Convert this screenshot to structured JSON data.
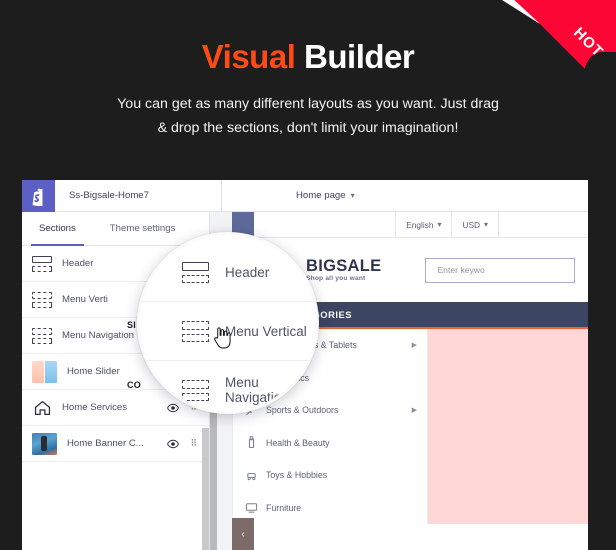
{
  "banner": {
    "title_part1": "Visual",
    "title_part2": "Builder",
    "subtitle_line1": "You can get as many different layouts as you want. Just drag",
    "subtitle_line2": "& drop the sections, don't limit your imagination!",
    "ribbon_label": "HOT",
    "colors": {
      "background": "#1e1d1d",
      "accent_orange": "#ff4a15",
      "ribbon_red": "#fb0635",
      "title_white": "#ffffff"
    }
  },
  "app": {
    "topbar": {
      "logo_icon": "shopify-bag-icon",
      "theme_name": "Ss-Bigsale-Home7",
      "page_selector_label": "Home page",
      "page_selector_caret": "⌄"
    },
    "sidebar": {
      "tabs": [
        {
          "label": "Sections",
          "active": true
        },
        {
          "label": "Theme settings",
          "active": false
        }
      ],
      "ghost_labels": [
        {
          "text": "SI"
        },
        {
          "text": "CO"
        }
      ],
      "sections": [
        {
          "label": "Header",
          "icon": "section-header-icon",
          "has_eye": false,
          "has_grip": false
        },
        {
          "label": "Menu Verti",
          "icon": "section-block-icon",
          "has_eye": false,
          "has_grip": false
        },
        {
          "label": "Menu Navigation",
          "icon": "section-block-icon",
          "has_eye": false,
          "has_grip": false
        },
        {
          "label": "Home Slider",
          "icon": "thumbnail-slider",
          "has_eye": true,
          "has_grip": true
        },
        {
          "label": "Home Services",
          "icon": "house-icon",
          "has_eye": true,
          "has_grip": true
        },
        {
          "label": "Home Banner C...",
          "icon": "thumbnail-photo",
          "has_eye": true,
          "has_grip": true
        }
      ]
    },
    "magnifier": {
      "items": [
        {
          "label": "Header",
          "icon": "section-header-icon"
        },
        {
          "label": "Menu Vertical",
          "icon": "section-block-icon"
        },
        {
          "label": "Menu Navigation",
          "icon": "section-block-icon"
        }
      ],
      "cursor": "pointer-hand-cursor"
    },
    "preview": {
      "utility_bar": [
        {
          "label": "English",
          "caret": "⌄"
        },
        {
          "label": "USD",
          "caret": "⌄"
        }
      ],
      "store": {
        "logo_name": "BIGSALE",
        "logo_tagline": "Shop all you want",
        "logo_icon": "shopping-basket-icon",
        "search_placeholder": "Enter keywo"
      },
      "categories_header": "ALL CATEGORIES",
      "categories": [
        {
          "label": "Smartphones & Tablets",
          "icon": "smartphone-icon",
          "has_arrow": true
        },
        {
          "label": "Electronics",
          "icon": "electronics-icon",
          "has_arrow": false
        },
        {
          "label": "Sports & Outdoors",
          "icon": "sports-icon",
          "has_arrow": true
        },
        {
          "label": "Health & Beauty",
          "icon": "beauty-bottle-icon",
          "has_arrow": false
        },
        {
          "label": "Toys & Hobbies",
          "icon": "toys-icon",
          "has_arrow": false
        },
        {
          "label": "Furniture",
          "icon": "furniture-icon",
          "has_arrow": false
        }
      ],
      "social": [
        {
          "name": "twitter-icon",
          "color": "#e05048"
        },
        {
          "name": "pinterest-icon",
          "color": "#dc2b2b"
        },
        {
          "name": "instagram-icon",
          "color": "#dd2a8b"
        }
      ],
      "back_button_glyph": "‹",
      "colors": {
        "nav_navy": "#3c4663",
        "nav_accent": "#f0622b",
        "banner_pink": "#ffd8d6"
      }
    }
  }
}
